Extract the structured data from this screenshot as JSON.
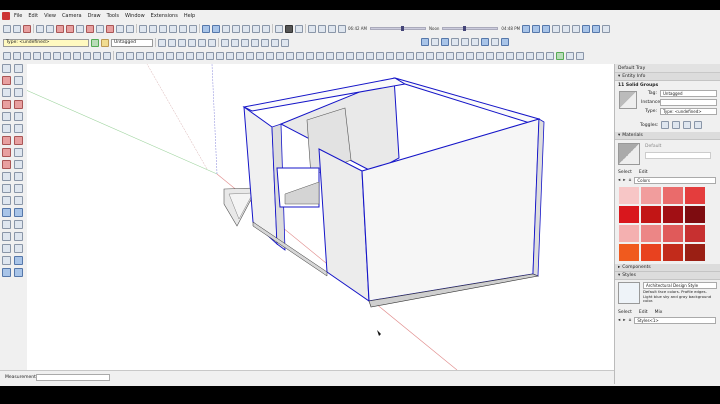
{
  "menu": [
    "File",
    "Edit",
    "View",
    "Camera",
    "Draw",
    "Tools",
    "Window",
    "Extensions",
    "Help"
  ],
  "shadow": {
    "time_left": "06:42 AM",
    "label": "Noon",
    "time_right": "04:48 PM"
  },
  "context": {
    "type_value": "Type: <undefined>",
    "tag_value": "Untagged"
  },
  "tray": {
    "title": "Default Tray",
    "entity_info": {
      "header": "Entity Info",
      "selection": "11 Solid Groups",
      "tag_label": "Tag:",
      "tag_value": "Untagged",
      "instance_label": "Instance:",
      "type_label": "Type:",
      "type_value": "Type: <undefined>",
      "toggles_label": "Toggles:"
    },
    "materials": {
      "header": "Materials",
      "name": "Default",
      "tab_select": "Select",
      "tab_edit": "Edit",
      "collection": "Colors",
      "swatches": [
        "#f7c6c6",
        "#f19d9d",
        "#ea6b6b",
        "#e43d3d",
        "#d9171d",
        "#c21515",
        "#a10f14",
        "#7e0c10",
        "#f4b0b0",
        "#ec8686",
        "#e05a5a",
        "#c73030",
        "#f05a1e",
        "#e8421f",
        "#c22b1b",
        "#9a1f14"
      ]
    },
    "components": {
      "header": "Components"
    },
    "styles": {
      "header": "Styles",
      "style_name": "Architectural Design Style",
      "description": "Default face colors. Profile edges. Light blue sky and gray background color.",
      "tab_select": "Select",
      "tab_edit": "Edit",
      "tab_mix": "Mix",
      "collection": "Styles<1>"
    }
  },
  "status": {
    "measurements_label": "Measurements"
  },
  "colors": {
    "edge_selected": "#1515c8",
    "axis_red": "#c83c3c",
    "axis_green": "#3c9a3c",
    "axis_blue": "#4a4ad8",
    "face": "#f6f6f6",
    "face_shade": "#d0d0d0"
  }
}
